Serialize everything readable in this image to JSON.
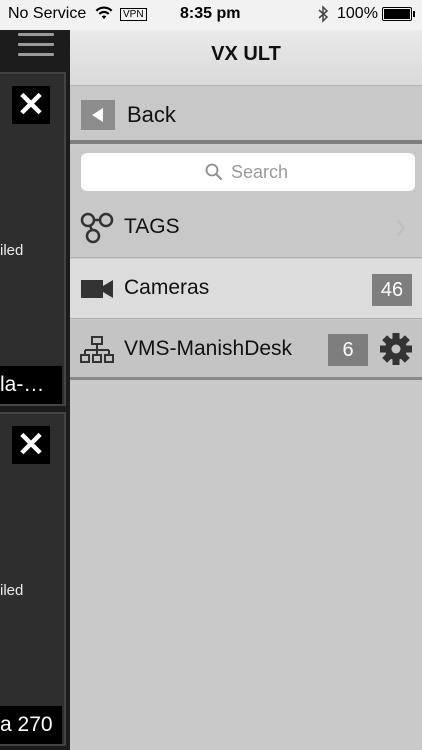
{
  "status_bar": {
    "carrier": "No Service",
    "vpn": "VPN",
    "time": "8:35 pm",
    "battery_percent": "100%",
    "battery_level": 1.0,
    "icons": [
      "wifi-icon",
      "bluetooth-icon",
      "battery-icon"
    ]
  },
  "left_tiles": [
    {
      "status": "iled",
      "caption": "la-…"
    },
    {
      "status": "iled",
      "caption": "a 270"
    }
  ],
  "left_icons": {
    "menu": "hamburger-icon",
    "close": "close-icon"
  },
  "close_glyph": "✕",
  "header": {
    "title": "VX ULT"
  },
  "back": {
    "label": "Back"
  },
  "search": {
    "placeholder": "Search"
  },
  "rows": [
    {
      "label": "TAGS",
      "icon": "tags-icon"
    },
    {
      "label": "Cameras",
      "icon": "camera-icon",
      "count": "46"
    },
    {
      "label": "VMS-ManishDesk",
      "icon": "network-icon",
      "count": "6"
    }
  ],
  "colors": {
    "panel_bg": "#c9c9c9",
    "badge_bg": "#7e7e7e",
    "selected_row_bg": "#dcdcdc",
    "left_column_bg": "#1c1c1c"
  }
}
